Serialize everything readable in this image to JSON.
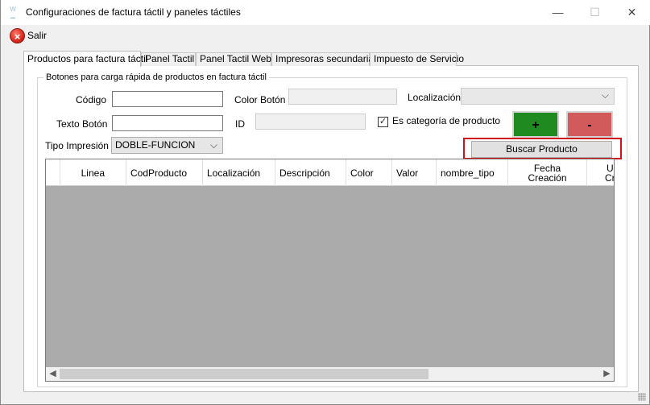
{
  "window": {
    "title": "Configuraciones de factura táctil y paneles táctiles",
    "minimize_glyph": "—",
    "maximize_glyph": "☐",
    "close_glyph": "✕"
  },
  "menu": {
    "exit_label": "Salir"
  },
  "tabs": [
    {
      "label": "Productos para factura táctil",
      "active": true
    },
    {
      "label": "Panel Tactil"
    },
    {
      "label": "Panel Tactil Web"
    },
    {
      "label": "Impresoras secundarias"
    },
    {
      "label": "Impuesto de Servicio"
    }
  ],
  "group": {
    "legend": "Botones para carga rápida de productos  en factura táctil",
    "codigo_label": "Código",
    "codigo_value": "",
    "color_boton_label": "Color Botón",
    "localizacion_label": "Localización",
    "localizacion_value": "",
    "texto_boton_label": "Texto Botón",
    "texto_boton_value": "",
    "id_label": "ID",
    "id_value": "",
    "es_categoria_label": "Es categoría de producto",
    "es_categoria_checked": true,
    "tipo_impresion_label": "Tipo Impresión",
    "tipo_impresion_value": "DOBLE-FUNCION",
    "add_label": "+",
    "remove_label": "-",
    "add_color": "#1f8a1f",
    "remove_color": "#d35a5a",
    "buscar_label": "Buscar Producto",
    "highlight_color": "#d0121b"
  },
  "table": {
    "columns": [
      {
        "label": "Linea"
      },
      {
        "label": "CodProducto"
      },
      {
        "label": "Localización"
      },
      {
        "label": "Descripción"
      },
      {
        "label": "Color"
      },
      {
        "label": "Valor"
      },
      {
        "label": "nombre_tipo"
      },
      {
        "label": "Fecha\nCreación"
      },
      {
        "label": "U\nCr"
      }
    ],
    "rows": []
  }
}
